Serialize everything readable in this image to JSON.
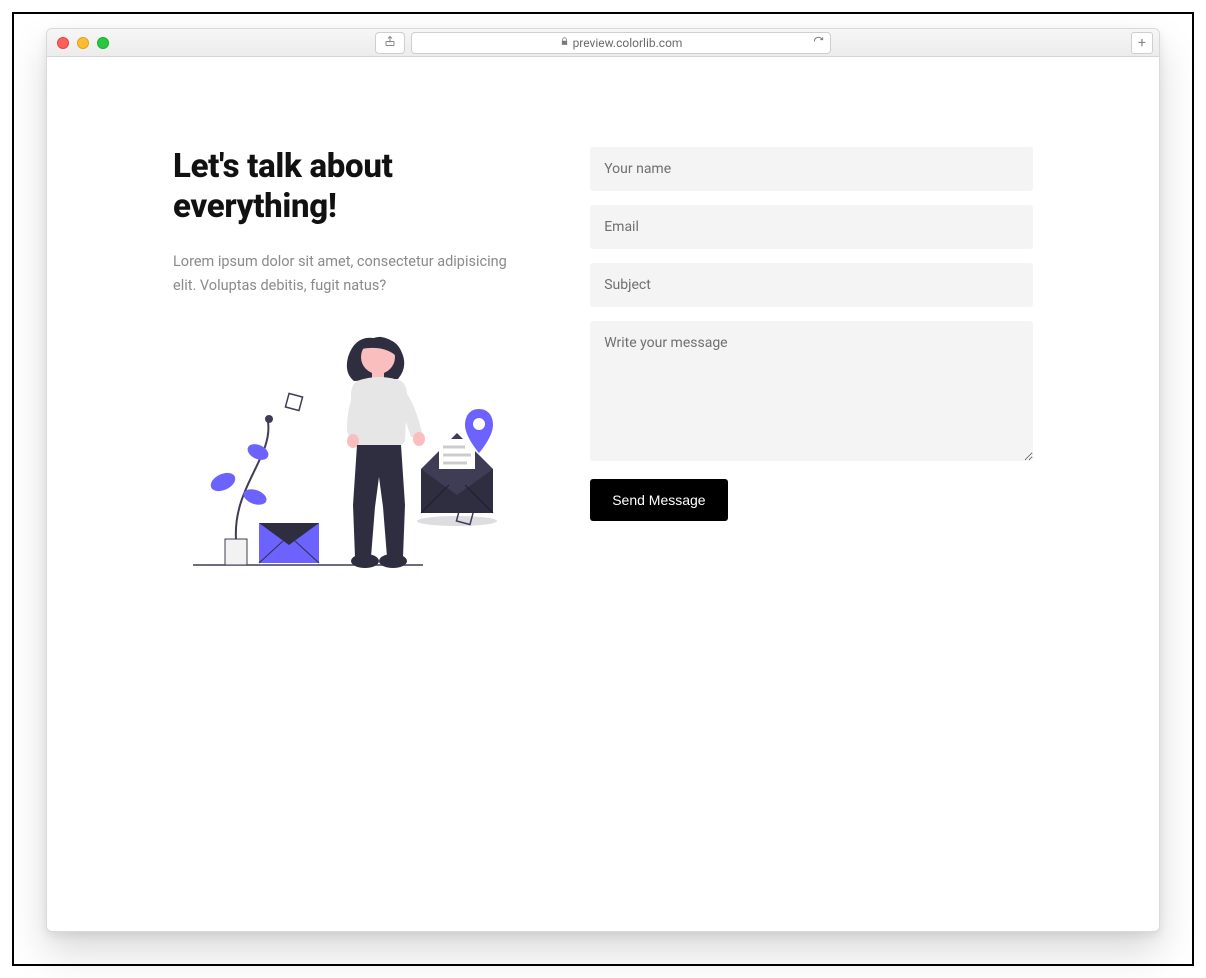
{
  "browser": {
    "url": "preview.colorlib.com"
  },
  "page": {
    "heading_line1": "Let's talk about",
    "heading_line2": "everything!",
    "subtext": "Lorem ipsum dolor sit amet, consectetur adipisicing elit. Voluptas debitis, fugit natus?"
  },
  "form": {
    "name_placeholder": "Your name",
    "email_placeholder": "Email",
    "subject_placeholder": "Subject",
    "message_placeholder": "Write your message",
    "submit_label": "Send Message"
  },
  "icons": {
    "share": "share-icon",
    "lock": "lock-icon",
    "reload": "reload-icon",
    "new_tab": "plus-icon"
  },
  "colors": {
    "accent_purple": "#6c63ff",
    "dark": "#2f2e41",
    "skin": "#fbbebe",
    "field_bg": "#f4f4f4",
    "button_bg": "#000000"
  }
}
